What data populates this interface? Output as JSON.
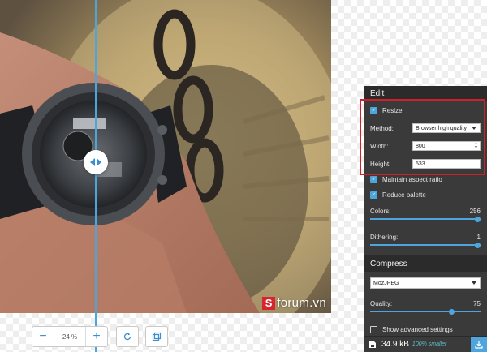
{
  "zoom": {
    "value": "24 %",
    "minus_label": "−",
    "plus_label": "+"
  },
  "watermark": {
    "logo_letter": "S",
    "text": "forum.vn"
  },
  "edit": {
    "header": "Edit",
    "resize": {
      "label": "Resize",
      "checked": true
    },
    "method": {
      "label": "Method:",
      "value": "Browser high quality"
    },
    "width": {
      "label": "Width:",
      "value": "800"
    },
    "height": {
      "label": "Height:",
      "value": "533"
    },
    "maintain_aspect": {
      "label": "Maintain aspect ratio",
      "checked": true
    },
    "reduce_palette": {
      "label": "Reduce palette",
      "checked": true
    },
    "colors": {
      "label": "Colors:",
      "value": "256",
      "fraction": 1.0
    },
    "dithering": {
      "label": "Dithering:",
      "value": "1",
      "fraction": 1.0
    }
  },
  "compress": {
    "header": "Compress",
    "codec": "MozJPEG",
    "quality": {
      "label": "Quality:",
      "value": "75",
      "fraction": 0.75
    },
    "advanced": {
      "label": "Show advanced settings",
      "checked": false
    }
  },
  "footer": {
    "size": "34.9 kB",
    "savings": "100% smaller"
  },
  "colors": {
    "accent": "#4ea4dc",
    "panel_bg": "#3a3a3a",
    "header_bg": "#2b2b2b",
    "highlight": "#d0212a",
    "savings_text": "#5bc0c8"
  }
}
